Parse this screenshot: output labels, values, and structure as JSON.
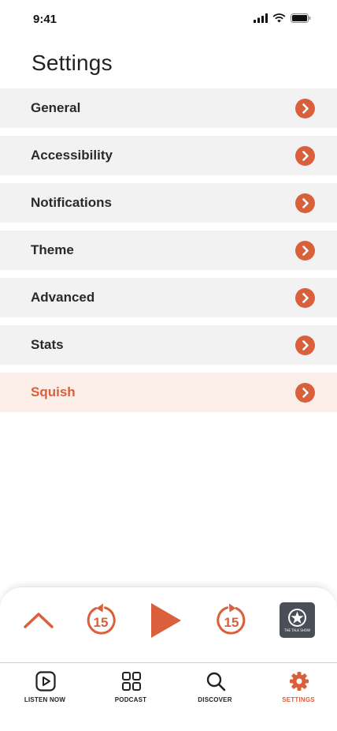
{
  "status_bar": {
    "time": "9:41"
  },
  "page": {
    "title": "Settings"
  },
  "settings": {
    "items": [
      {
        "label": "General"
      },
      {
        "label": "Accessibility"
      },
      {
        "label": "Notifications"
      },
      {
        "label": "Theme"
      },
      {
        "label": "Advanced"
      },
      {
        "label": "Stats"
      },
      {
        "label": "Squish"
      }
    ]
  },
  "player": {
    "skip_back_seconds": "15",
    "skip_forward_seconds": "15",
    "artwork_text": "THE TALK SHOW"
  },
  "tabs": [
    {
      "label": "LISTEN NOW",
      "icon": "listen-now-icon"
    },
    {
      "label": "PODCAST",
      "icon": "grid-icon"
    },
    {
      "label": "DISCOVER",
      "icon": "search-icon"
    },
    {
      "label": "SETTINGS",
      "icon": "gear-icon"
    }
  ],
  "colors": {
    "accent": "#D9603A",
    "row_bg": "#F2F2F2",
    "highlight_bg": "#FBEEE9"
  }
}
